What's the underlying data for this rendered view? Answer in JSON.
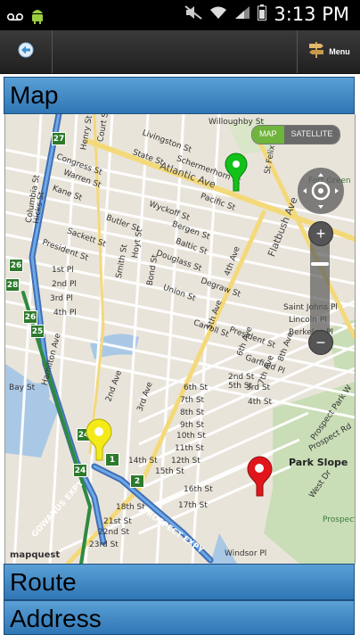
{
  "status_bar": {
    "time": "3:13 PM"
  },
  "action_bar": {
    "menu_label": "Menu"
  },
  "panels": {
    "map": "Map",
    "route": "Route",
    "address": "Address"
  },
  "map": {
    "type_toggle": {
      "map": "MAP",
      "satellite": "SATELLITE"
    },
    "zoom": {
      "in": "+",
      "out": "−"
    },
    "attribution": "mapquest",
    "routes": [
      "27",
      "26",
      "28",
      "26",
      "25",
      "24",
      "24",
      "1",
      "2"
    ],
    "streets": {
      "willoughby": "Willoughby St",
      "livingston": "Livingston St",
      "state": "State St",
      "schermerhorn": "Schermerhorn St",
      "atlantic": "Atlantic Ave",
      "congress": "Congress St",
      "warren": "Warren St",
      "kane": "Kane St",
      "columbia": "Columbia St",
      "hicks": "Hicks St",
      "henry": "Henry St",
      "court": "Court St",
      "wyckoff": "Wyckoff St",
      "butler": "Butler St",
      "pacific": "Pacific St",
      "sackett": "Sackett St",
      "president": "President St",
      "first_pl": "1st Pl",
      "second_pl": "2nd Pl",
      "third_pl": "3rd Pl",
      "fourth_pl": "4th Pl",
      "bergen": "Bergen St",
      "baltic": "Baltic St",
      "douglass": "Douglass St",
      "hoyt": "Hoyt St",
      "smith": "Smith St",
      "bond": "Bond St",
      "union": "Union St",
      "degraw": "Degraw St",
      "carroll": "Carroll St",
      "president2": "President St",
      "garfield": "Garfield Pl",
      "second_st": "2nd St",
      "third_st": "3rd St",
      "fourth_st": "4th St",
      "fifth_st": "5th St",
      "sixth_st": "6th St",
      "seventh_st": "7th St",
      "eighth_st": "8th St",
      "ninth_st": "9th St",
      "tenth_st": "10th St",
      "eleventh_st": "11th St",
      "twelfth_st": "12th St",
      "fourteenth_st": "14th St",
      "fifteenth_st": "15th St",
      "sixteenth_st": "16th St",
      "seventeenth_st": "17th St",
      "eighteenth_st": "18th St",
      "twentyfirst_st": "21st St",
      "twentysecond_st": "22nd St",
      "twentythird_st": "23rd St",
      "fourth_ave": "4th Ave",
      "fifth_ave": "5th Ave",
      "sixth_ave": "6th Ave",
      "seventh_ave": "7th Ave",
      "eighth_ave": "8th Ave",
      "second_ave": "2nd Ave",
      "third_ave": "3rd Ave",
      "flatbush": "Flatbush Ave",
      "st_johns": "Saint Johns Pl",
      "lincoln": "Lincoln Pl",
      "berkeley": "Berkeley Pl",
      "st_felix": "St Felix St",
      "ft_green": "Fort Green",
      "prospect_park_w": "Prospect Park W",
      "prospect_rd": "Prospect Rd",
      "park_slope": "Park Slope",
      "west_dr": "West Dr",
      "gowanus": "GOWANUS EXPY",
      "prospect_expy": "PROSPECT EXPY",
      "windsor": "Windsor Pl",
      "prospect": "Prospect",
      "bay": "Bay St",
      "hamilton": "Hamilton Ave"
    }
  }
}
